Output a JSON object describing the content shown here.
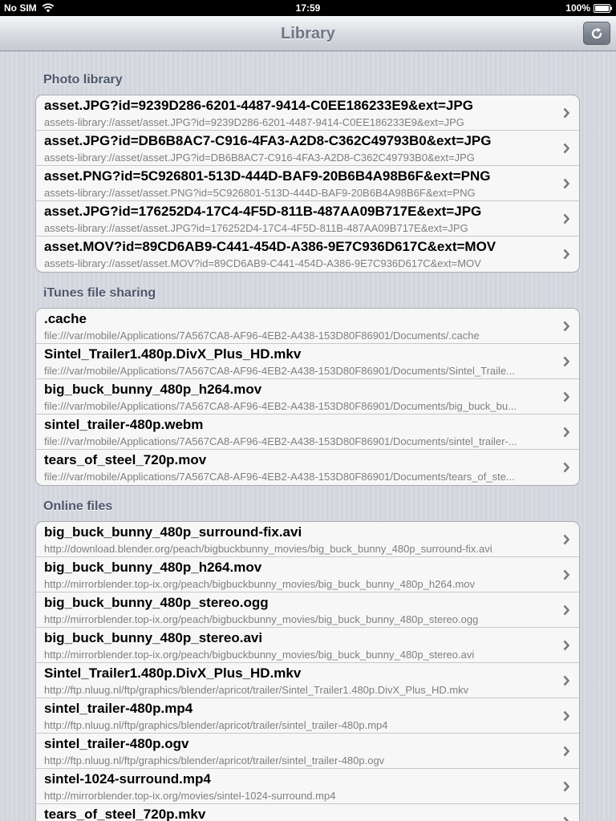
{
  "status": {
    "carrier": "No SIM",
    "time": "17:59",
    "battery": "100%"
  },
  "nav": {
    "title": "Library",
    "refresh_icon": "refresh-icon"
  },
  "photo_library": {
    "header": "Photo library",
    "items": [
      {
        "title": "asset.JPG?id=9239D286-6201-4487-9414-C0EE186233E9&ext=JPG",
        "subtitle": "assets-library://asset/asset.JPG?id=9239D286-6201-4487-9414-C0EE186233E9&ext=JPG"
      },
      {
        "title": "asset.JPG?id=DB6B8AC7-C916-4FA3-A2D8-C362C49793B0&ext=JPG",
        "subtitle": "assets-library://asset/asset.JPG?id=DB6B8AC7-C916-4FA3-A2D8-C362C49793B0&ext=JPG"
      },
      {
        "title": "asset.PNG?id=5C926801-513D-444D-BAF9-20B6B4A98B6F&ext=PNG",
        "subtitle": "assets-library://asset/asset.PNG?id=5C926801-513D-444D-BAF9-20B6B4A98B6F&ext=PNG"
      },
      {
        "title": "asset.JPG?id=176252D4-17C4-4F5D-811B-487AA09B717E&ext=JPG",
        "subtitle": "assets-library://asset/asset.JPG?id=176252D4-17C4-4F5D-811B-487AA09B717E&ext=JPG"
      },
      {
        "title": "asset.MOV?id=89CD6AB9-C441-454D-A386-9E7C936D617C&ext=MOV",
        "subtitle": "assets-library://asset/asset.MOV?id=89CD6AB9-C441-454D-A386-9E7C936D617C&ext=MOV"
      }
    ]
  },
  "itunes_sharing": {
    "header": "iTunes file sharing",
    "items": [
      {
        "title": ".cache",
        "subtitle": "file:///var/mobile/Applications/7A567CA8-AF96-4EB2-A438-153D80F86901/Documents/.cache"
      },
      {
        "title": "Sintel_Trailer1.480p.DivX_Plus_HD.mkv",
        "subtitle": "file:///var/mobile/Applications/7A567CA8-AF96-4EB2-A438-153D80F86901/Documents/Sintel_Traile..."
      },
      {
        "title": "big_buck_bunny_480p_h264.mov",
        "subtitle": "file:///var/mobile/Applications/7A567CA8-AF96-4EB2-A438-153D80F86901/Documents/big_buck_bu..."
      },
      {
        "title": "sintel_trailer-480p.webm",
        "subtitle": "file:///var/mobile/Applications/7A567CA8-AF96-4EB2-A438-153D80F86901/Documents/sintel_trailer-..."
      },
      {
        "title": "tears_of_steel_720p.mov",
        "subtitle": "file:///var/mobile/Applications/7A567CA8-AF96-4EB2-A438-153D80F86901/Documents/tears_of_ste..."
      }
    ]
  },
  "online_files": {
    "header": "Online files",
    "items": [
      {
        "title": "big_buck_bunny_480p_surround-fix.avi",
        "subtitle": "http://download.blender.org/peach/bigbuckbunny_movies/big_buck_bunny_480p_surround-fix.avi"
      },
      {
        "title": "big_buck_bunny_480p_h264.mov",
        "subtitle": "http://mirrorblender.top-ix.org/peach/bigbuckbunny_movies/big_buck_bunny_480p_h264.mov"
      },
      {
        "title": "big_buck_bunny_480p_stereo.ogg",
        "subtitle": "http://mirrorblender.top-ix.org/peach/bigbuckbunny_movies/big_buck_bunny_480p_stereo.ogg"
      },
      {
        "title": "big_buck_bunny_480p_stereo.avi",
        "subtitle": "http://mirrorblender.top-ix.org/peach/bigbuckbunny_movies/big_buck_bunny_480p_stereo.avi"
      },
      {
        "title": "Sintel_Trailer1.480p.DivX_Plus_HD.mkv",
        "subtitle": "http://ftp.nluug.nl/ftp/graphics/blender/apricot/trailer/Sintel_Trailer1.480p.DivX_Plus_HD.mkv"
      },
      {
        "title": "sintel_trailer-480p.mp4",
        "subtitle": "http://ftp.nluug.nl/ftp/graphics/blender/apricot/trailer/sintel_trailer-480p.mp4"
      },
      {
        "title": "sintel_trailer-480p.ogv",
        "subtitle": "http://ftp.nluug.nl/ftp/graphics/blender/apricot/trailer/sintel_trailer-480p.ogv"
      },
      {
        "title": "sintel-1024-surround.mp4",
        "subtitle": "http://mirrorblender.top-ix.org/movies/sintel-1024-surround.mp4"
      },
      {
        "title": "tears_of_steel_720p.mkv",
        "subtitle": ""
      }
    ]
  }
}
